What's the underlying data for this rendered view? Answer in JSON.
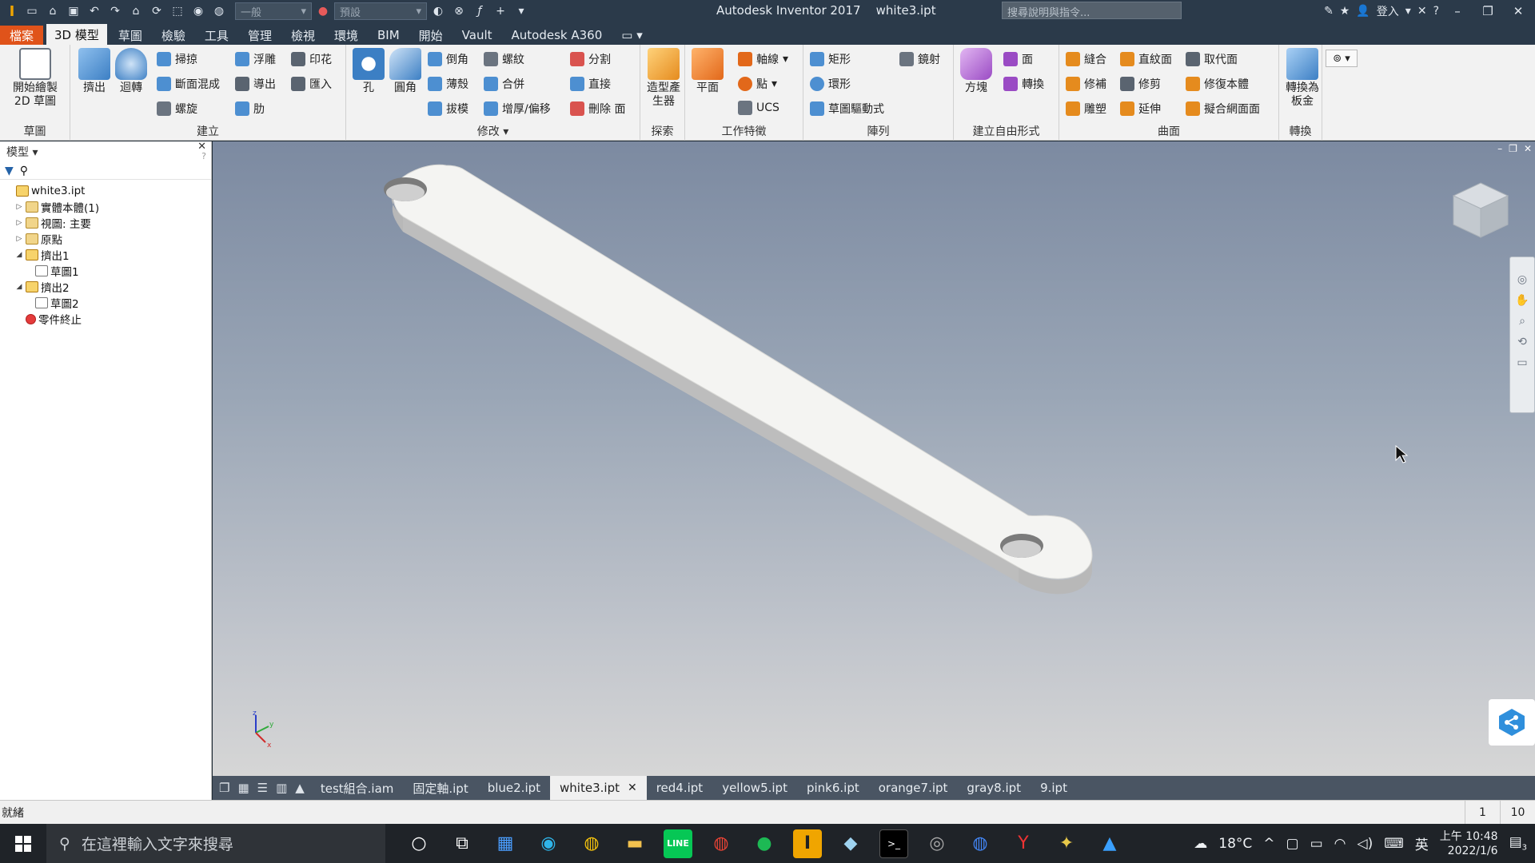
{
  "titlebar": {
    "app_title": "Autodesk Inventor 2017",
    "file_title": "white3.ipt",
    "style_combo": "一般",
    "appearance_combo": "預設",
    "search_placeholder": "搜尋說明與指令...",
    "sign_in": "登入"
  },
  "tabs": [
    "檔案",
    "3D 模型",
    "草圖",
    "檢驗",
    "工具",
    "管理",
    "檢視",
    "環境",
    "BIM",
    "開始",
    "Vault",
    "Autodesk A360"
  ],
  "ribbon": {
    "panels": {
      "sketch": "草圖",
      "create": "建立",
      "modify": "修改",
      "explore": "探索",
      "work_features": "工作特徵",
      "pattern": "陣列",
      "freeform": "建立自由形式",
      "surface": "曲面",
      "convert": "轉換"
    },
    "buttons": {
      "start_2d_sketch": "開始繪製 2D 草圖",
      "extrude": "擠出",
      "revolve": "迴轉",
      "sweep": "掃掠",
      "loft": "斷面混成",
      "coil": "螺旋",
      "emboss": "浮雕",
      "derive": "導出",
      "rib": "肋",
      "decal": "印花",
      "import": "匯入",
      "hole": "孔",
      "fillet": "圓角",
      "chamfer": "倒角",
      "shell": "薄殼",
      "draft": "拔模",
      "thread": "螺紋",
      "combine": "合併",
      "thicken": "增厚/偏移",
      "split": "分割",
      "direct": "直接",
      "delete_face": "刪除 面",
      "shape_generator": "造型產生器",
      "plane": "平面",
      "axis": "軸線",
      "point": "點",
      "ucs": "UCS",
      "rectangular": "矩形",
      "circular": "環形",
      "sketch_driven": "草圖驅動式",
      "mirror": "鏡射",
      "box": "方塊",
      "face": "面",
      "convert_ff": "轉換",
      "stitch": "縫合",
      "patch": "修補",
      "sculpt": "雕塑",
      "ruled": "直紋面",
      "trim": "修剪",
      "extend": "延伸",
      "replace_face": "取代面",
      "repair_bodies": "修復本體",
      "fit_mesh": "擬合網面面",
      "convert_sheet": "轉換為板金"
    }
  },
  "browser": {
    "header": "模型",
    "nodes": [
      {
        "label": "white3.ipt",
        "indent": 0,
        "toggle": "",
        "icon": "part"
      },
      {
        "label": "實體本體(1)",
        "indent": 1,
        "toggle": "▷",
        "icon": "solid"
      },
      {
        "label": "視圖: 主要",
        "indent": 1,
        "toggle": "▷",
        "icon": "view"
      },
      {
        "label": "原點",
        "indent": 1,
        "toggle": "▷",
        "icon": "folder"
      },
      {
        "label": "擠出1",
        "indent": 1,
        "toggle": "◢",
        "icon": "extrude"
      },
      {
        "label": "草圖1",
        "indent": 2,
        "toggle": "",
        "icon": "sketch"
      },
      {
        "label": "擠出2",
        "indent": 1,
        "toggle": "◢",
        "icon": "extrude"
      },
      {
        "label": "草圖2",
        "indent": 2,
        "toggle": "",
        "icon": "sketch"
      },
      {
        "label": "零件終止",
        "indent": 1,
        "toggle": "",
        "icon": "end"
      }
    ]
  },
  "doc_tabs": [
    {
      "label": "test組合.iam",
      "active": false
    },
    {
      "label": "固定軸.ipt",
      "active": false
    },
    {
      "label": "blue2.ipt",
      "active": false
    },
    {
      "label": "white3.ipt",
      "active": true
    },
    {
      "label": "red4.ipt",
      "active": false
    },
    {
      "label": "yellow5.ipt",
      "active": false
    },
    {
      "label": "pink6.ipt",
      "active": false
    },
    {
      "label": "orange7.ipt",
      "active": false
    },
    {
      "label": "gray8.ipt",
      "active": false
    },
    {
      "label": "9.ipt",
      "active": false
    }
  ],
  "status": {
    "text": "就緒",
    "num1": "1",
    "num2": "10"
  },
  "taskbar": {
    "search_placeholder": "在這裡輸入文字來搜尋",
    "temperature": "18°C",
    "ime": "英",
    "time": "上午 10:48",
    "date": "2022/1/6",
    "notifications": "3"
  },
  "colors": {
    "file_tab": "#e0531a",
    "titlebar": "#2b3a4a",
    "ribbon": "#f2f2f2",
    "viewport_top": "#7c8aa1",
    "viewport_bottom": "#d6d6d6"
  }
}
